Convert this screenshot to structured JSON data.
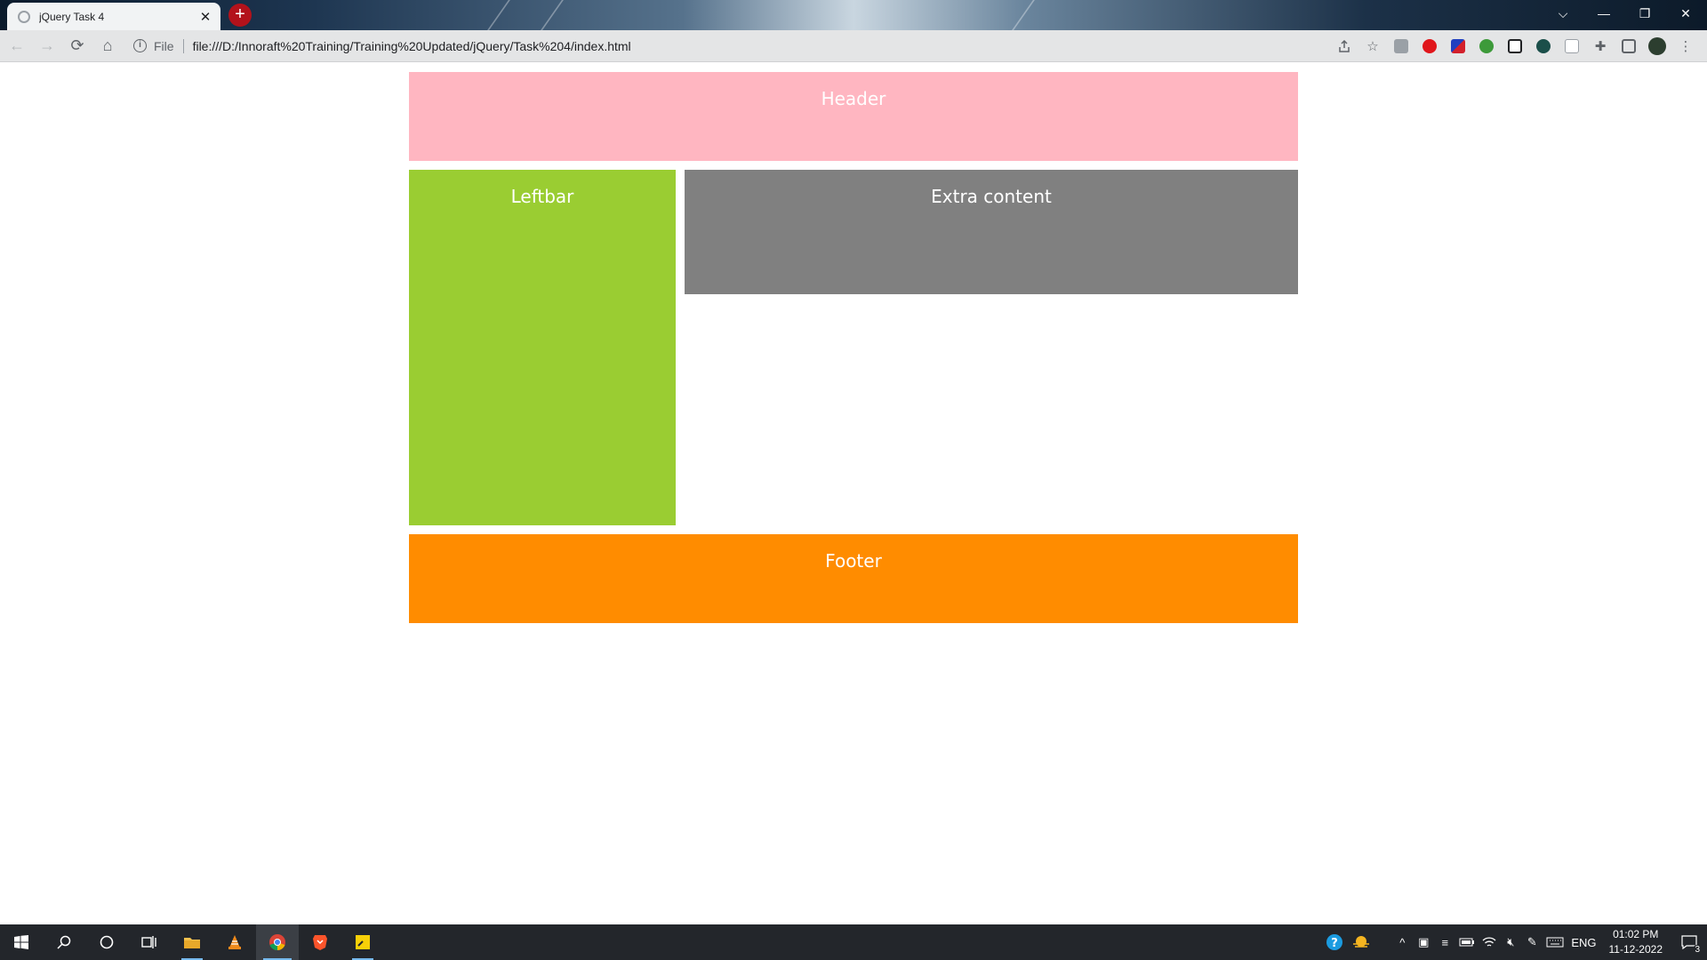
{
  "browser": {
    "tab_title": "jQuery Task 4",
    "tab_close": "✕",
    "new_tab": "+",
    "window_controls": {
      "chevron": "⌵",
      "minimize": "—",
      "restore": "❐",
      "close": "✕"
    },
    "nav": {
      "back": "←",
      "forward": "→",
      "reload": "⟳",
      "home": "⌂"
    },
    "address": {
      "info_icon": "i",
      "scheme_label": "File",
      "url": "file:///D:/Innoraft%20Training/Training%20Updated/jQuery/Task%204/index.html"
    },
    "toolbar_icons": [
      "share-icon",
      "star-icon",
      "extension-icons",
      "puzzle-icon",
      "sidepanel-icon",
      "profile-avatar",
      "menu-icon"
    ]
  },
  "page": {
    "header": "Header",
    "leftbar": "Leftbar",
    "extra": "Extra content",
    "footer": "Footer"
  },
  "colors": {
    "header": "#ffb6c1",
    "leftbar": "#9acd32",
    "extra": "#808080",
    "footer": "#ff8c00"
  },
  "taskbar": {
    "apps": [
      "start-icon",
      "search-icon",
      "cortana-icon",
      "task-view-icon",
      "file-explorer-icon",
      "vlc-icon",
      "chrome-icon",
      "brave-icon",
      "sticky-notes-icon"
    ],
    "tray": {
      "language": "ENG",
      "time": "01:02 PM",
      "date": "11-12-2022",
      "notifications": "3"
    }
  }
}
